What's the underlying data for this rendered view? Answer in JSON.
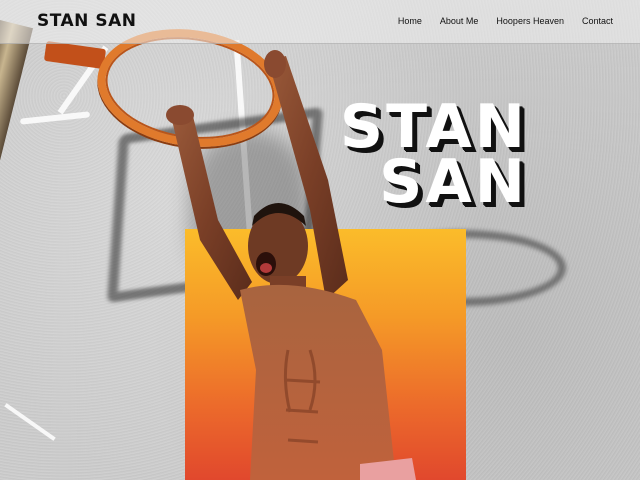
{
  "header": {
    "brand": "STAN SAN",
    "nav": [
      {
        "label": "Home"
      },
      {
        "label": "About Me"
      },
      {
        "label": "Hoopers Heaven"
      },
      {
        "label": "Contact"
      }
    ]
  },
  "hero": {
    "title_line1": "STAN",
    "title_line2": "SAN",
    "block_colors": [
      "#fbbc2a",
      "#e1482d"
    ]
  }
}
